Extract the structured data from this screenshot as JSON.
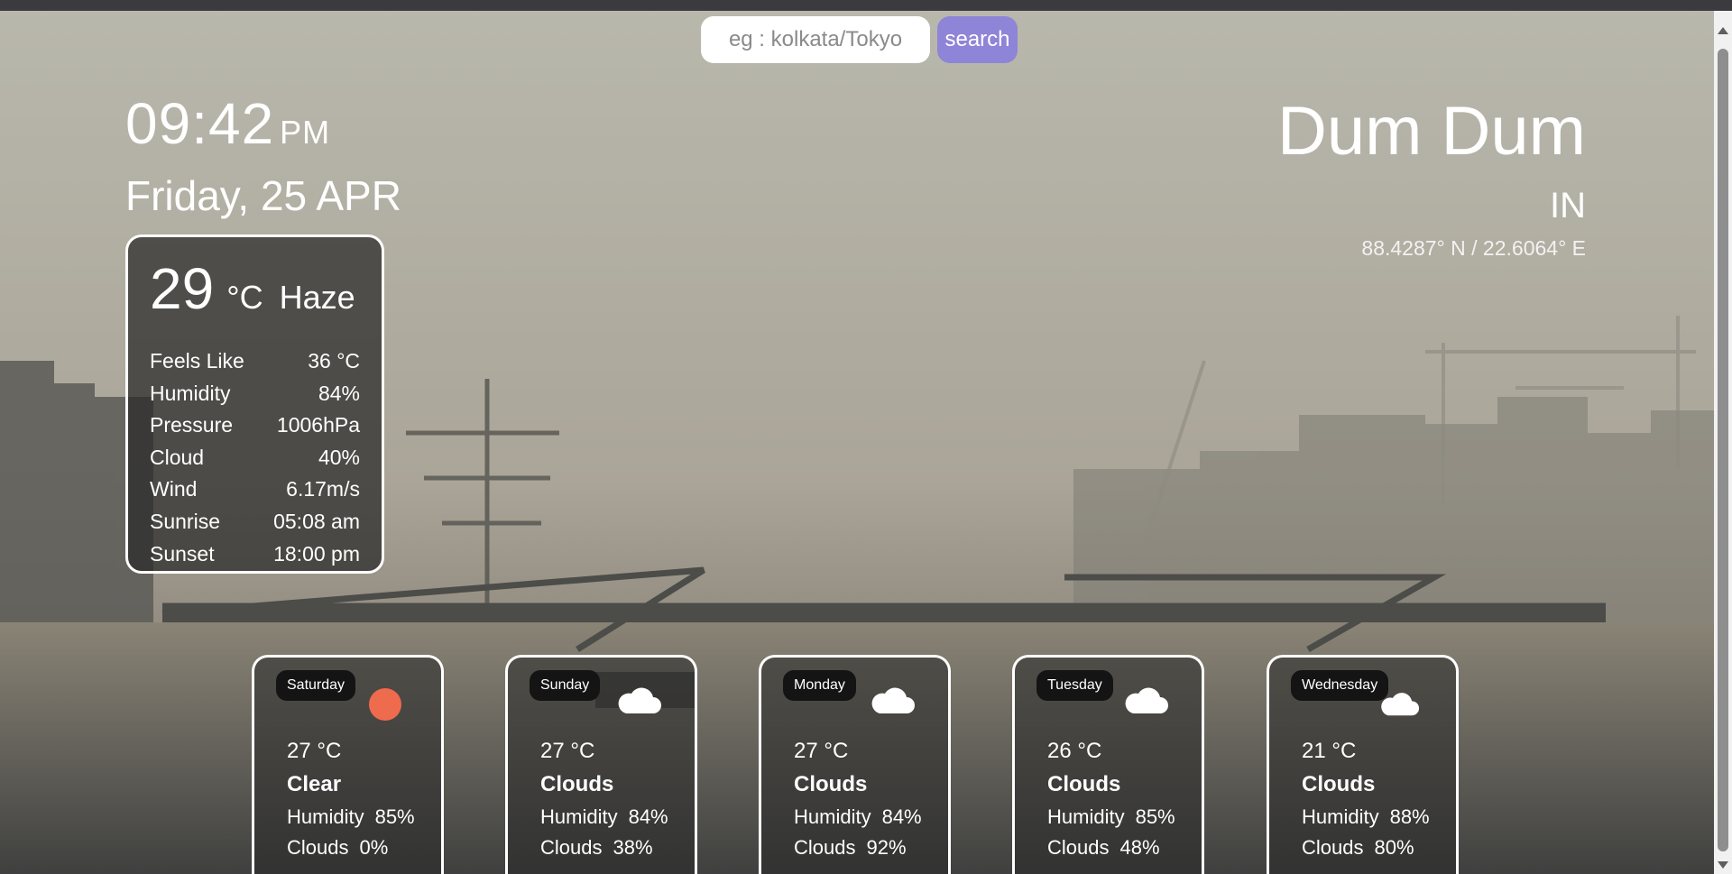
{
  "search": {
    "placeholder": "eg : kolkata/Tokyo",
    "value": "",
    "button_label": "search"
  },
  "clock": {
    "time": "09:42",
    "ampm": "PM",
    "date": "Friday, 25 APR"
  },
  "location": {
    "city": "Dum Dum",
    "country": "IN",
    "coords": "88.4287° N / 22.6064° E"
  },
  "current": {
    "temp": "29",
    "unit": "°C",
    "condition": "Haze",
    "details": [
      {
        "label": "Feels Like",
        "value": "36 °C"
      },
      {
        "label": "Humidity",
        "value": "84%"
      },
      {
        "label": "Pressure",
        "value": "1006hPa"
      },
      {
        "label": "Cloud",
        "value": "40%"
      },
      {
        "label": "Wind",
        "value": "6.17m/s"
      },
      {
        "label": "Sunrise",
        "value": "05:08 am"
      },
      {
        "label": "Sunset",
        "value": "18:00 pm"
      }
    ]
  },
  "forecast": [
    {
      "day": "Saturday",
      "icon": "sun-icon",
      "temp": "27 °C",
      "condition": "Clear",
      "humidity_label": "Humidity",
      "humidity": "85%",
      "clouds_label": "Clouds",
      "clouds": "0%"
    },
    {
      "day": "Sunday",
      "icon": "cloud-icon",
      "temp": "27 °C",
      "condition": "Clouds",
      "humidity_label": "Humidity",
      "humidity": "84%",
      "clouds_label": "Clouds",
      "clouds": "38%"
    },
    {
      "day": "Monday",
      "icon": "cloud-icon",
      "temp": "27 °C",
      "condition": "Clouds",
      "humidity_label": "Humidity",
      "humidity": "84%",
      "clouds_label": "Clouds",
      "clouds": "92%"
    },
    {
      "day": "Tuesday",
      "icon": "cloud-icon",
      "temp": "26 °C",
      "condition": "Clouds",
      "humidity_label": "Humidity",
      "humidity": "85%",
      "clouds_label": "Clouds",
      "clouds": "48%"
    },
    {
      "day": "Wednesday",
      "icon": "cloud-icon",
      "temp": "21 °C",
      "condition": "Clouds",
      "humidity_label": "Humidity",
      "humidity": "88%",
      "clouds_label": "Clouds",
      "clouds": "80%"
    }
  ],
  "colors": {
    "search_button": "#8e84d8",
    "sun": "#ee6b4d",
    "card_border": "#ffffff"
  }
}
